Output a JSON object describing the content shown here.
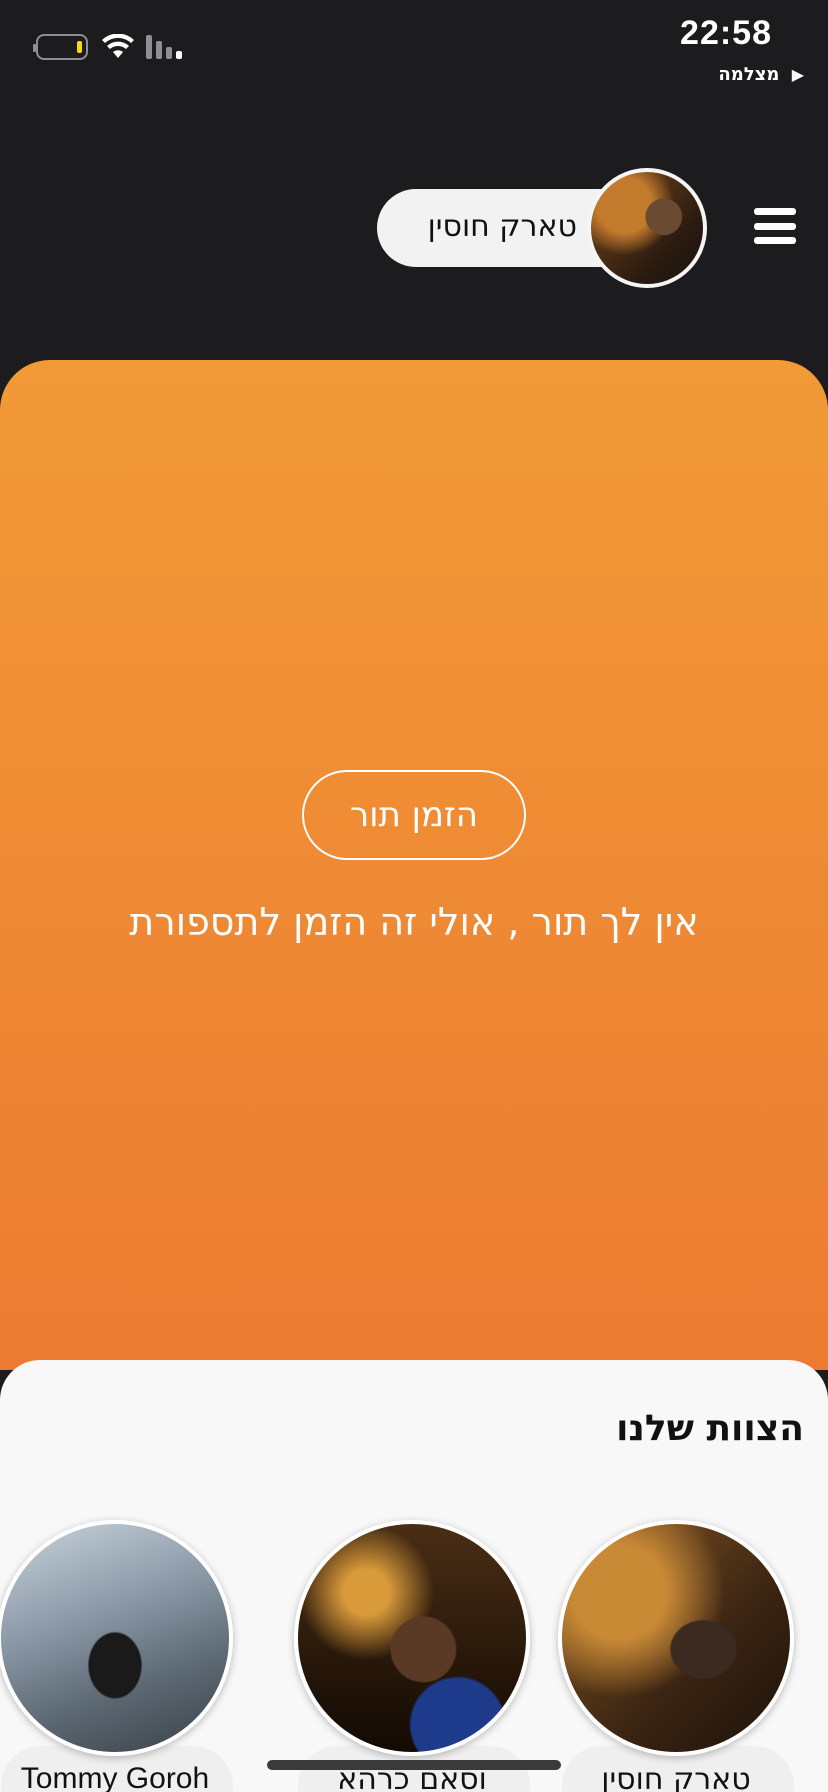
{
  "status_bar": {
    "time": "22:58",
    "back_app": "מצלמה",
    "back_arrow": "▶"
  },
  "header": {
    "user_name": "טארק חוסין",
    "menu_icon": "hamburger-menu-icon"
  },
  "hero": {
    "book_button_label": "הזמן תור",
    "message": "אין לך תור ,  אולי זה הזמן לתספורת",
    "gradient_top": "#f19a37",
    "gradient_bottom": "#ec7b31"
  },
  "team": {
    "title": "הצוות שלנו",
    "members": [
      {
        "name": "טארק חוסין"
      },
      {
        "name": "וסאם כרהא"
      },
      {
        "name": "Tommy Goroh"
      }
    ]
  }
}
